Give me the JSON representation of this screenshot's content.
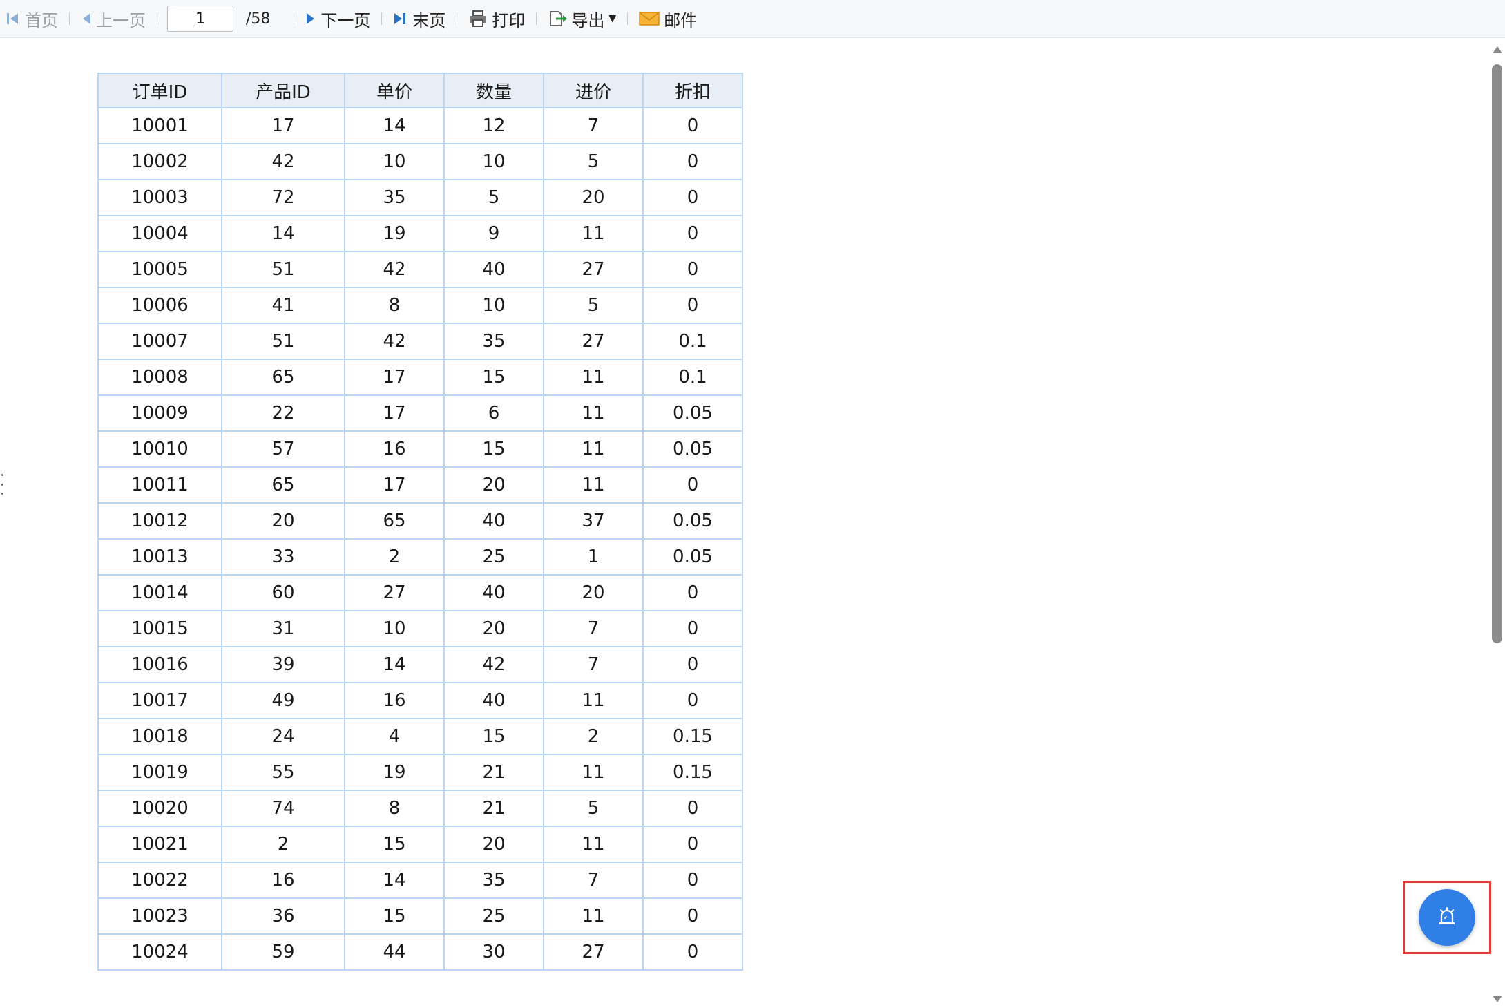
{
  "toolbar": {
    "first_label": "首页",
    "prev_label": "上一页",
    "page_value": "1",
    "page_total": "/58",
    "next_label": "下一页",
    "last_label": "末页",
    "print_label": "打印",
    "export_label": "导出",
    "mail_label": "邮件"
  },
  "table": {
    "headers": [
      "订单ID",
      "产品ID",
      "单价",
      "数量",
      "进价",
      "折扣"
    ],
    "rows": [
      [
        "10001",
        "17",
        "14",
        "12",
        "7",
        "0"
      ],
      [
        "10002",
        "42",
        "10",
        "10",
        "5",
        "0"
      ],
      [
        "10003",
        "72",
        "35",
        "5",
        "20",
        "0"
      ],
      [
        "10004",
        "14",
        "19",
        "9",
        "11",
        "0"
      ],
      [
        "10005",
        "51",
        "42",
        "40",
        "27",
        "0"
      ],
      [
        "10006",
        "41",
        "8",
        "10",
        "5",
        "0"
      ],
      [
        "10007",
        "51",
        "42",
        "35",
        "27",
        "0.1"
      ],
      [
        "10008",
        "65",
        "17",
        "15",
        "11",
        "0.1"
      ],
      [
        "10009",
        "22",
        "17",
        "6",
        "11",
        "0.05"
      ],
      [
        "10010",
        "57",
        "16",
        "15",
        "11",
        "0.05"
      ],
      [
        "10011",
        "65",
        "17",
        "20",
        "11",
        "0"
      ],
      [
        "10012",
        "20",
        "65",
        "40",
        "37",
        "0.05"
      ],
      [
        "10013",
        "33",
        "2",
        "25",
        "1",
        "0.05"
      ],
      [
        "10014",
        "60",
        "27",
        "40",
        "20",
        "0"
      ],
      [
        "10015",
        "31",
        "10",
        "20",
        "7",
        "0"
      ],
      [
        "10016",
        "39",
        "14",
        "42",
        "7",
        "0"
      ],
      [
        "10017",
        "49",
        "16",
        "40",
        "11",
        "0"
      ],
      [
        "10018",
        "24",
        "4",
        "15",
        "2",
        "0.15"
      ],
      [
        "10019",
        "55",
        "19",
        "21",
        "11",
        "0.15"
      ],
      [
        "10020",
        "74",
        "8",
        "21",
        "5",
        "0"
      ],
      [
        "10021",
        "2",
        "15",
        "20",
        "11",
        "0"
      ],
      [
        "10022",
        "16",
        "14",
        "35",
        "7",
        "0"
      ],
      [
        "10023",
        "36",
        "15",
        "25",
        "11",
        "0"
      ],
      [
        "10024",
        "59",
        "44",
        "30",
        "27",
        "0"
      ]
    ]
  },
  "colors": {
    "accent": "#2f7fe6",
    "highlight_border": "#e53935",
    "table_border": "#b9d7f4",
    "header_bg": "#e8eef6"
  },
  "icons": {
    "first": "first-page-icon",
    "prev": "prev-page-icon",
    "next": "next-page-icon",
    "last": "last-page-icon",
    "print": "printer-icon",
    "export": "export-icon",
    "mail": "mail-icon",
    "float": "alarm-icon"
  }
}
